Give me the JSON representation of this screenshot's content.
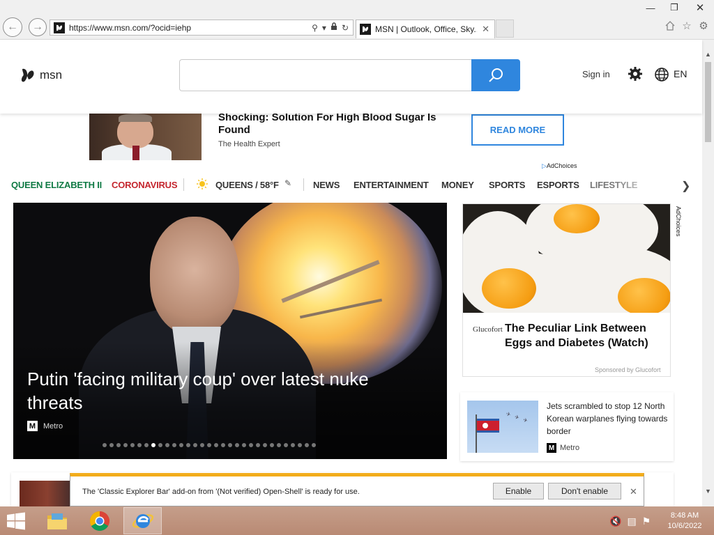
{
  "browser": {
    "url": "https://www.msn.com/?ocid=iehp",
    "tab_title": "MSN | Outlook, Office, Sky...",
    "window_controls": {
      "minimize": "—",
      "maximize": "❐",
      "close": "✕"
    }
  },
  "header": {
    "logo_text": "msn",
    "search_placeholder": "",
    "sign_in": "Sign in",
    "language": "EN"
  },
  "ad_banner": {
    "title": "Shocking: Solution For High Blood Sugar Is Found",
    "source": "The Health Expert",
    "cta": "READ MORE",
    "adchoices": "AdChoices"
  },
  "nav": {
    "items": [
      {
        "label": "QUEEN ELIZABETH II",
        "style": "green"
      },
      {
        "label": "CORONAVIRUS",
        "style": "red"
      },
      {
        "label": "QUEENS / 58°F",
        "style": "weather"
      },
      {
        "label": "NEWS"
      },
      {
        "label": "ENTERTAINMENT"
      },
      {
        "label": "MONEY"
      },
      {
        "label": "SPORTS"
      },
      {
        "label": "ESPORTS"
      },
      {
        "label": "LIFESTYLE"
      }
    ],
    "colors": {
      "green": "#0f7a44",
      "red": "#c4262e"
    }
  },
  "hero": {
    "title": "Putin 'facing military coup' over latest nuke threats",
    "source": "Metro",
    "carousel_total": 31,
    "carousel_active": 8
  },
  "side_ad": {
    "brand": "Glucofort",
    "title": "The Peculiar Link Between Eggs and Diabetes (Watch)",
    "sponsor": "Sponsored by Glucofort",
    "adchoices": "AdChoices"
  },
  "news_card": {
    "title": "Jets scrambled to stop 12 North Korean warplanes flying towards border",
    "source": "Metro"
  },
  "notification": {
    "message": "The 'Classic Explorer Bar' add-on from '(Not verified) Open-Shell' is ready for use.",
    "enable": "Enable",
    "dont_enable": "Don't enable",
    "accent": "#f2ac1c"
  },
  "taskbar": {
    "time": "8:48 AM",
    "date": "10/6/2022"
  }
}
